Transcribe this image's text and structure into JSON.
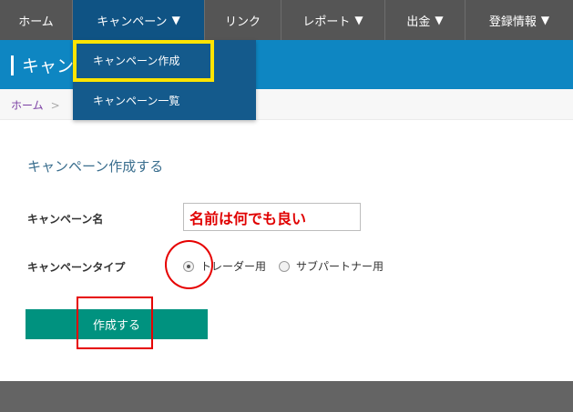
{
  "nav": {
    "items": [
      {
        "label": "ホーム",
        "has_arrow": false
      },
      {
        "label": "キャンペーン",
        "has_arrow": true,
        "active": true
      },
      {
        "label": "リンク",
        "has_arrow": false
      },
      {
        "label": "レポート",
        "has_arrow": true
      },
      {
        "label": "出金",
        "has_arrow": true
      },
      {
        "label": "登録情報",
        "has_arrow": true
      }
    ],
    "arrow_glyph": "▼",
    "background": "#555555",
    "active_background": "#0f5384"
  },
  "banner": {
    "title": "キャン",
    "background": "#0e86c2"
  },
  "breadcrumb": {
    "home": "ホーム",
    "separator": ">"
  },
  "dropdown": {
    "items": [
      "キャンペーン作成",
      "キャンペーン一覧"
    ],
    "highlight_color": "#ffe400"
  },
  "form": {
    "section_title": "キャンペーン作成する",
    "name_label": "キャンペーン名",
    "name_value": "名前は何でも良い",
    "name_value_color": "#e00000",
    "type_label": "キャンペーンタイプ",
    "type_options": [
      {
        "label": "トレーダー用",
        "checked": true
      },
      {
        "label": "サブパートナー用",
        "checked": false
      }
    ],
    "submit_label": "作成する",
    "submit_color": "#00927f"
  },
  "annotations": {
    "color": "#e60000"
  }
}
